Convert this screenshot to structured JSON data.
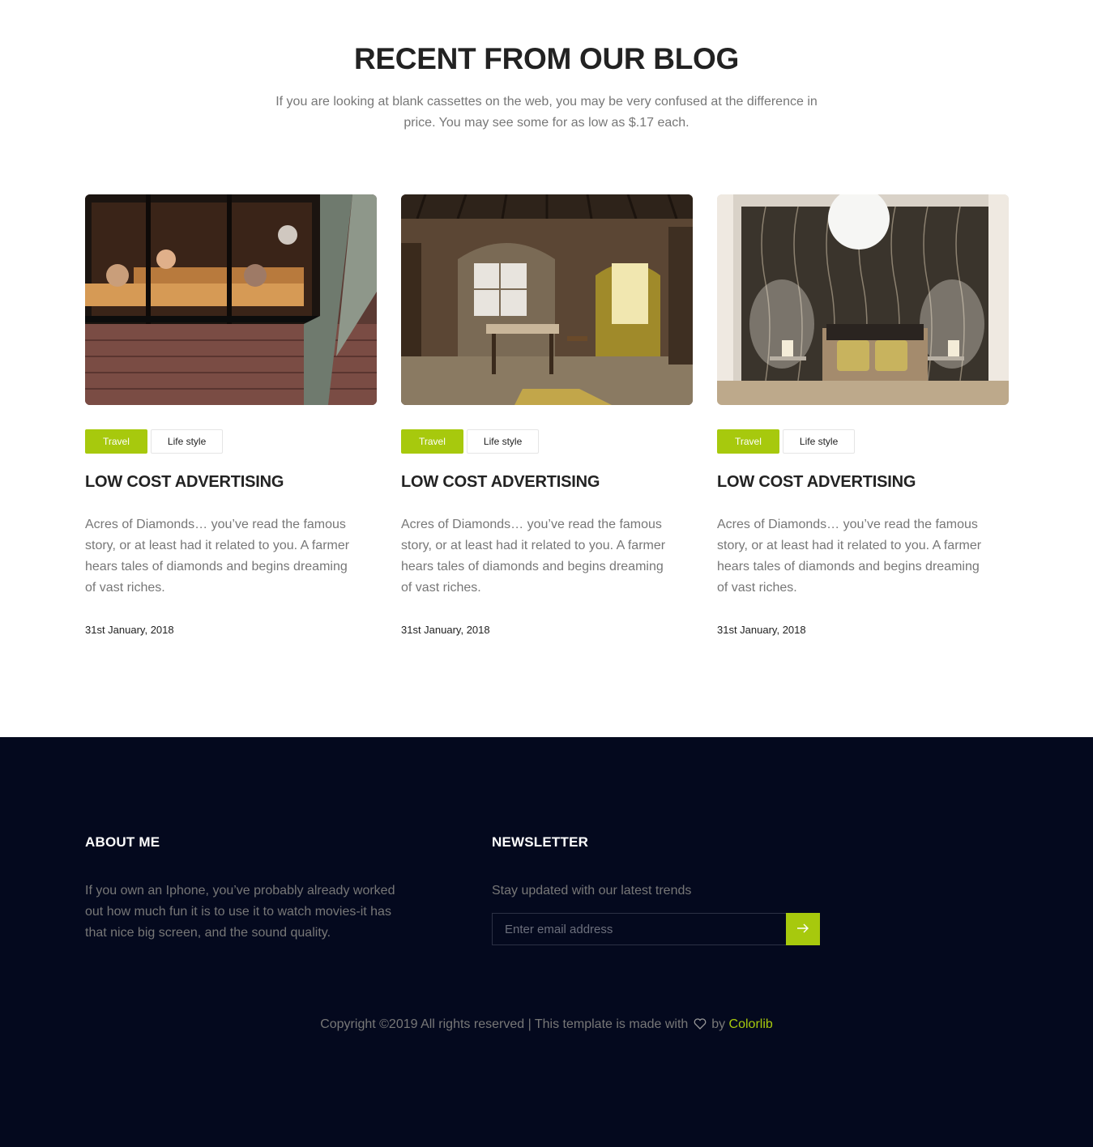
{
  "blog": {
    "title": "RECENT FROM OUR BLOG",
    "subtitle": "If you are looking at blank cassettes on the web, you may be very confused at the difference in price. You may see some for as low as $.17 each.",
    "posts": [
      {
        "image": "cafe-overhead-photo",
        "tags": [
          "Travel",
          "Life style"
        ],
        "title": "LOW COST ADVERTISING",
        "excerpt": "Acres of Diamonds… you’ve read the famous story, or at least had it related to you. A farmer hears tales of diamonds and begins dreaming of vast riches.",
        "date": "31st January, 2018"
      },
      {
        "image": "old-wooden-room-photo",
        "tags": [
          "Travel",
          "Life style"
        ],
        "title": "LOW COST ADVERTISING",
        "excerpt": "Acres of Diamonds… you’ve read the famous story, or at least had it related to you. A farmer hears tales of diamonds and begins dreaming of vast riches.",
        "date": "31st January, 2018"
      },
      {
        "image": "bedroom-photo",
        "tags": [
          "Travel",
          "Life style"
        ],
        "title": "LOW COST ADVERTISING",
        "excerpt": "Acres of Diamonds… you’ve read the famous story, or at least had it related to you. A farmer hears tales of diamonds and begins dreaming of vast riches.",
        "date": "31st January, 2018"
      }
    ]
  },
  "footer": {
    "about": {
      "title": "ABOUT ME",
      "text": "If you own an Iphone, you’ve probably already worked out how much fun it is to use it to watch movies-it has that nice big screen, and the sound quality."
    },
    "newsletter": {
      "title": "NEWSLETTER",
      "text": "Stay updated with our latest trends",
      "placeholder": "Enter email address",
      "button_icon": "arrow-right-icon"
    },
    "copyright": {
      "prefix": "Copyright ©2019 All rights reserved | This template is made with",
      "icon": "heart-icon",
      "by": "by",
      "link": "Colorlib"
    }
  },
  "colors": {
    "accent": "#a7c90d",
    "footer_bg": "#04091e",
    "body_text": "#777777",
    "heading": "#222222"
  }
}
